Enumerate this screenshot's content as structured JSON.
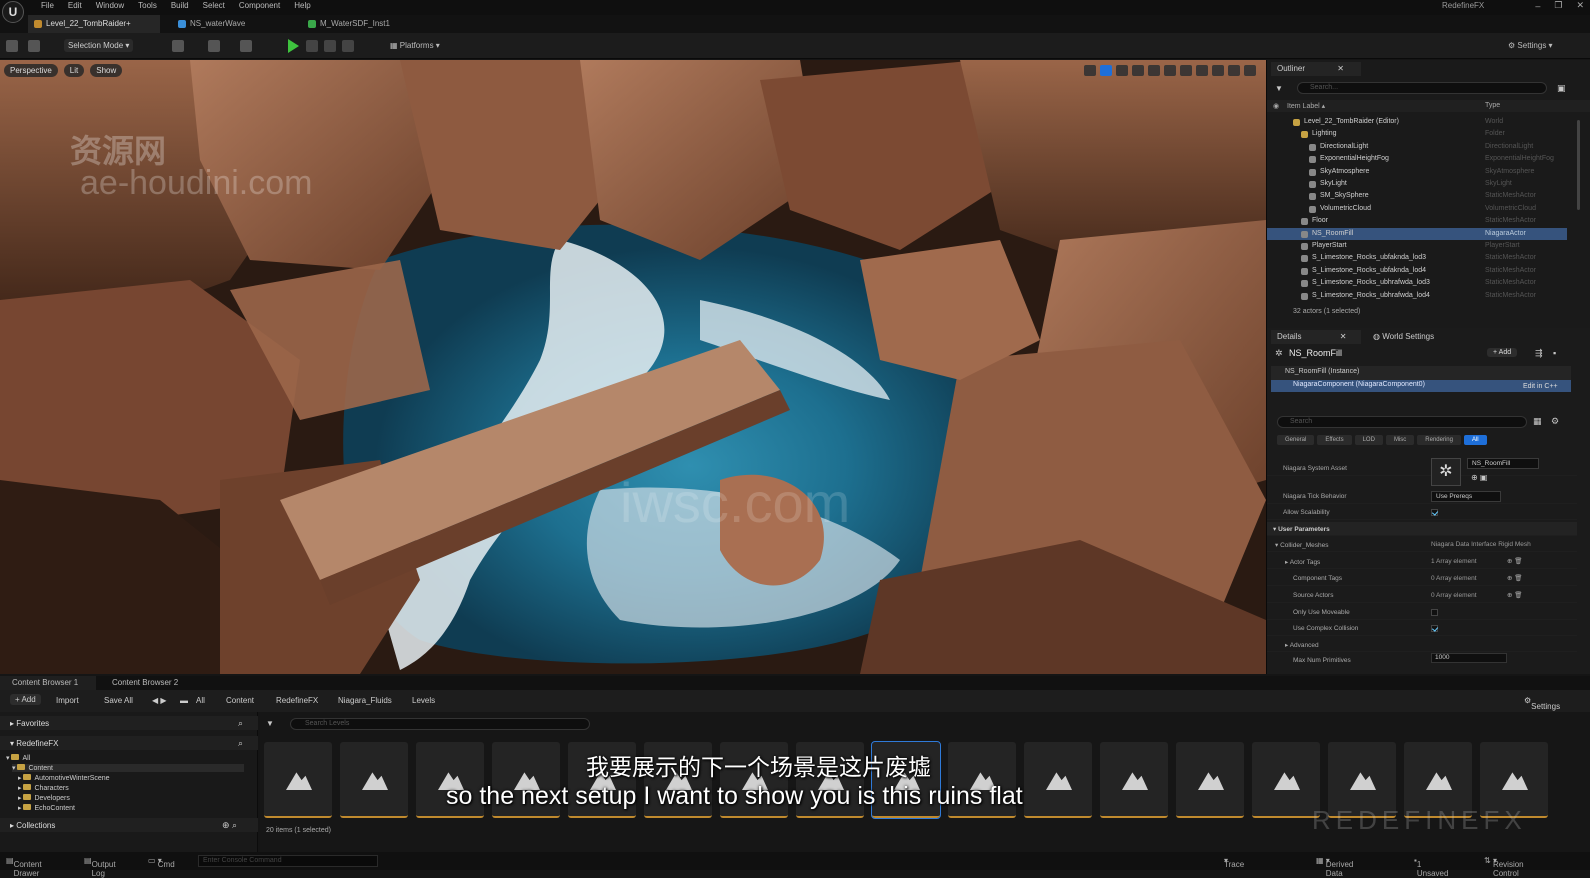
{
  "menu": [
    "File",
    "Edit",
    "Window",
    "Tools",
    "Build",
    "Select",
    "Component",
    "Help"
  ],
  "project_name": "RedefineFX",
  "tabs": [
    "Level_22_TombRaider+",
    "NS_waterWave",
    "M_WaterSDF_Inst1"
  ],
  "toolbar": {
    "selection_mode": "Selection Mode",
    "platforms": "Platforms",
    "settings": "Settings"
  },
  "viewport": {
    "perspective": "Perspective",
    "lit": "Lit",
    "show": "Show",
    "watermark_cn": "资源网",
    "watermark_url": "ae-houdini.com",
    "watermark_center": "iwsc.com"
  },
  "outliner": {
    "tab": "Outliner",
    "search_placeholder": "Search...",
    "col_label": "Item Label ▴",
    "col_type": "Type",
    "rows": [
      {
        "label": "Level_22_TombRaider (Editor)",
        "type": "World"
      },
      {
        "label": "Lighting",
        "type": "Folder"
      },
      {
        "label": "DirectionalLight",
        "type": "DirectionalLight"
      },
      {
        "label": "ExponentialHeightFog",
        "type": "ExponentialHeightFog"
      },
      {
        "label": "SkyAtmosphere",
        "type": "SkyAtmosphere"
      },
      {
        "label": "SkyLight",
        "type": "SkyLight"
      },
      {
        "label": "SM_SkySphere",
        "type": "StaticMeshActor"
      },
      {
        "label": "VolumetricCloud",
        "type": "VolumetricCloud"
      },
      {
        "label": "Floor",
        "type": "StaticMeshActor"
      },
      {
        "label": "NS_RoomFill",
        "type": "NiagaraActor"
      },
      {
        "label": "PlayerStart",
        "type": "PlayerStart"
      },
      {
        "label": "S_Limestone_Rocks_ubfaknda_lod3",
        "type": "StaticMeshActor"
      },
      {
        "label": "S_Limestone_Rocks_ubfaknda_lod4",
        "type": "StaticMeshActor"
      },
      {
        "label": "S_Limestone_Rocks_ubhrafwda_lod3",
        "type": "StaticMeshActor"
      },
      {
        "label": "S_Limestone_Rocks_ubhrafwda_lod4",
        "type": "StaticMeshActor"
      }
    ],
    "actor_count": "32 actors (1 selected)"
  },
  "details": {
    "tab": "Details",
    "tab2": "World Settings",
    "name": "NS_RoomFill",
    "add": "+ Add",
    "instance": "NS_RoomFill (Instance)",
    "component": "NiagaraComponent (NiagaraComponent0)",
    "edit_cpp": "Edit in C++",
    "search_placeholder": "Search",
    "filters": [
      "General",
      "Effects",
      "LOD",
      "Misc",
      "Rendering",
      "All"
    ],
    "props": {
      "system_asset": "Niagara System Asset",
      "system_asset_value": "NS_RoomFill",
      "tick_behavior": "Niagara Tick Behavior",
      "tick_value": "Use Prereqs",
      "allow_scalability": "Allow Scalability",
      "user_params": "User Parameters",
      "collider_meshes": "Collider_Meshes",
      "collider_value": "Niagara Data Interface Rigid Mesh",
      "actor_tags": "Actor Tags",
      "actor_tags_value": "1 Array element",
      "component_tags": "Component Tags",
      "component_tags_value": "0 Array element",
      "source_actors": "Source Actors",
      "source_actors_value": "0 Array element",
      "only_movable": "Only Use Moveable",
      "use_complex": "Use Complex Collision",
      "advanced": "Advanced",
      "max_primitives": "Max Num Primitives",
      "max_primitives_value": "1000"
    }
  },
  "content_browser": {
    "tabs": [
      "Content Browser 1",
      "Content Browser 2"
    ],
    "add": "+ Add",
    "import": "Import",
    "save_all": "Save All",
    "path": [
      "All",
      "Content",
      "RedefineFX",
      "Niagara_Fluids",
      "Levels"
    ],
    "settings": "Settings",
    "favorites": "Favorites",
    "project": "RedefineFX",
    "tree": [
      "All",
      "Content",
      "AutomotiveWinterScene",
      "Characters",
      "Developers",
      "EchoContent"
    ],
    "collections": "Collections",
    "search_placeholder": "Search Levels",
    "item_count": "20 items (1 selected)"
  },
  "subtitles": {
    "cn": "我要展示的下一个场景是这片废墟",
    "en": "so the next setup I want to show you is this ruins flat"
  },
  "brand": "REDEFINEFX",
  "statusbar": {
    "content_drawer": "Content Drawer",
    "output_log": "Output Log",
    "cmd": "Cmd",
    "console_placeholder": "Enter Console Command",
    "trace": "Trace",
    "derived_data": "Derived Data",
    "unsaved": "1 Unsaved",
    "revision": "Revision Control"
  }
}
